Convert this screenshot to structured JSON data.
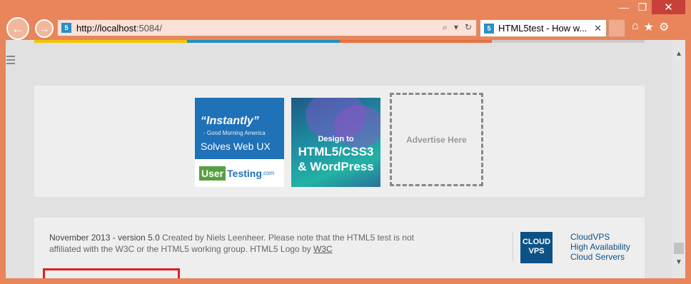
{
  "browser": {
    "window_buttons": {
      "minimize": "—",
      "restore": "❐",
      "close": "✕"
    },
    "back_icon": "back-arrow-icon",
    "forward_icon": "forward-arrow-icon",
    "address": {
      "host_part": "http://localhost",
      "rest_part": ":5084/",
      "site_badge": "5"
    },
    "address_tools": {
      "search": "⌕",
      "dropdown": "▾",
      "refresh": "↻"
    },
    "tab": {
      "title": "HTML5test - How w...",
      "badge": "5",
      "close": "✕"
    },
    "command_icons": {
      "home": "⌂",
      "favorites": "★",
      "settings": "⚙"
    }
  },
  "page": {
    "color_stripes": [
      "#f2c500",
      "#1d91c0",
      "#e9703c",
      "#cccccc"
    ],
    "ads": {
      "usertesting": {
        "quote": "“Instantly”",
        "attribution": "- Good Morning America",
        "tagline": "Solves Web UX",
        "logo_user": "User",
        "logo_testing": "Testing",
        "logo_com": ".com"
      },
      "design_book": {
        "line1": "Design to",
        "line2": "HTML5/CSS3",
        "line3": "& WordPress"
      },
      "placeholder": "Advertise Here"
    },
    "footer": {
      "version": "November 2013 - version 5.0",
      "text_after_version": " Created by Niels Leenheer. Please note that the HTML5 test is not affiliated with the W3C or the HTML5 working group. HTML5 Logo by ",
      "w3c_link": "W3C",
      "sponsor_logo_line1": "CLOUD",
      "sponsor_logo_line2": "VPS",
      "sponsor_name": "CloudVPS",
      "sponsor_line2": "High Availability",
      "sponsor_line3": "Cloud Servers"
    }
  },
  "scrollbar": {
    "up": "▲",
    "down": "▼"
  }
}
